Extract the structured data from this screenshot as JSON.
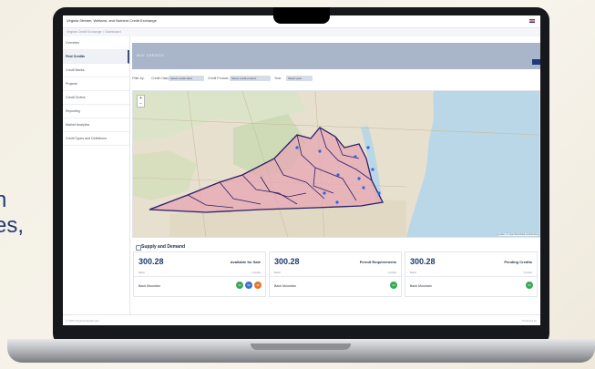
{
  "background": {
    "lines": [
      "n",
      "es,"
    ],
    "color": "#243a72"
  },
  "app": {
    "title": "Virginia Stream, Wetland, and Nutrient Credit Exchange",
    "breadcrumb": "Virginia Credit Exchange > Dashboard",
    "header_title": "BUY CREDITS"
  },
  "sidebar": {
    "items": [
      "Overview",
      "Find Credits",
      "Credit Banks",
      "Projects",
      "Credit Orders",
      "Reporting",
      "Market Analytics",
      "Credit Types and Definitions"
    ],
    "active_index": 1,
    "footer": "© 2024 All Rights Reserved"
  },
  "filters": {
    "label": "Filter by:",
    "items": [
      {
        "label": "Credit Class:",
        "value": "Select credit class"
      },
      {
        "label": "Credit Product:",
        "value": "Select credit product"
      },
      {
        "label": "Year:",
        "value": "Select year"
      }
    ]
  },
  "map": {
    "zoom_in": "+",
    "zoom_out": "−",
    "attribution": "Leaflet | © OpenStreetMap contributors"
  },
  "supply": {
    "title": "Supply and Demand",
    "cards": [
      {
        "value": "300.28",
        "label": "Available for Sale",
        "sub_left": "Bank",
        "sub_right": "Credits",
        "row_name": "Back Mountain",
        "pills": [
          {
            "text": "23",
            "color": "#3aa65a"
          },
          {
            "text": "52",
            "color": "#3c73c6"
          },
          {
            "text": "26",
            "color": "#e0782c"
          }
        ]
      },
      {
        "value": "300.28",
        "label": "Permit Requirements",
        "sub_left": "Bank",
        "sub_right": "Credits",
        "row_name": "Back Mountain",
        "pills": [
          {
            "text": "23",
            "color": "#3aa65a"
          }
        ]
      },
      {
        "value": "300.28",
        "label": "Pending Credits",
        "sub_left": "Bank",
        "sub_right": "Credits",
        "row_name": "Back Mountain",
        "pills": [
          {
            "text": "23",
            "color": "#3aa65a"
          }
        ]
      }
    ]
  },
  "footer": {
    "left": "© 2024 Virginia Department",
    "right": "Powered by"
  }
}
